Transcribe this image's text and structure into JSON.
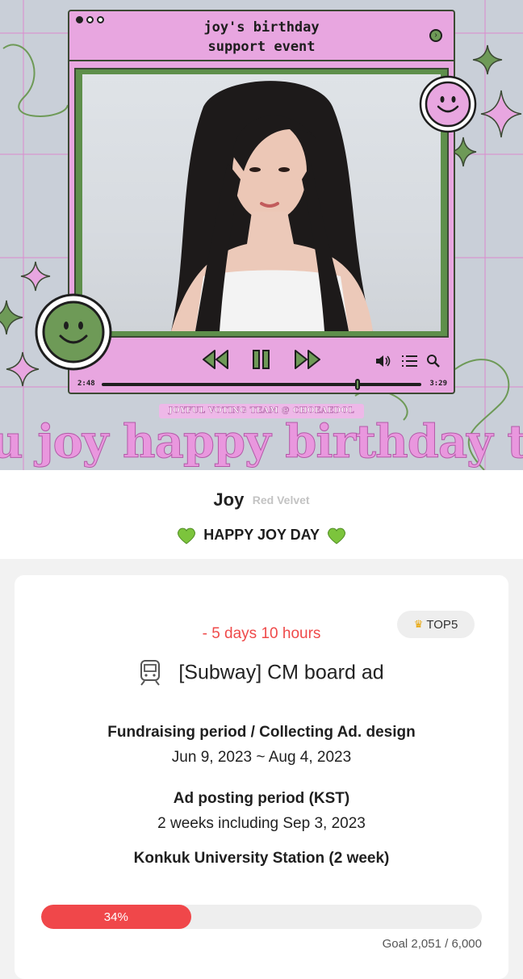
{
  "banner": {
    "player_title_line1": "joy's birthday",
    "player_title_line2": "support event",
    "time_elapsed": "2:48",
    "time_total": "3:29",
    "playback_fraction": 0.8,
    "team_tag": "JOYFUL VOTING TEAM @ CHOEAEDOL",
    "marquee_text": "u joy happy birthday to yo",
    "colors": {
      "pink": "#e8a6e0",
      "green": "#6e9a57",
      "outline": "#3c4a34"
    }
  },
  "artist": {
    "name": "Joy",
    "group": "Red Velvet",
    "headline": "HAPPY JOY DAY",
    "heart_icon": "green-heart-icon"
  },
  "event": {
    "countdown": "- 5 days 10 hours",
    "rank_label": "TOP5",
    "rank_icon": "crown-icon",
    "title": "[Subway] CM board ad",
    "title_icon": "subway-train-icon",
    "fundraising_label": "Fundraising period / Collecting Ad. design",
    "fundraising_value": "Jun 9, 2023 ~ Aug 4, 2023",
    "posting_label": "Ad posting period (KST)",
    "posting_value": "2 weeks including Sep 3, 2023",
    "location": "Konkuk University Station (2 week)",
    "progress_label": "34%",
    "progress_fraction": 0.34,
    "goal_text": "Goal 2,051 / 6,000",
    "colors": {
      "accent_red": "#f0474a"
    }
  }
}
